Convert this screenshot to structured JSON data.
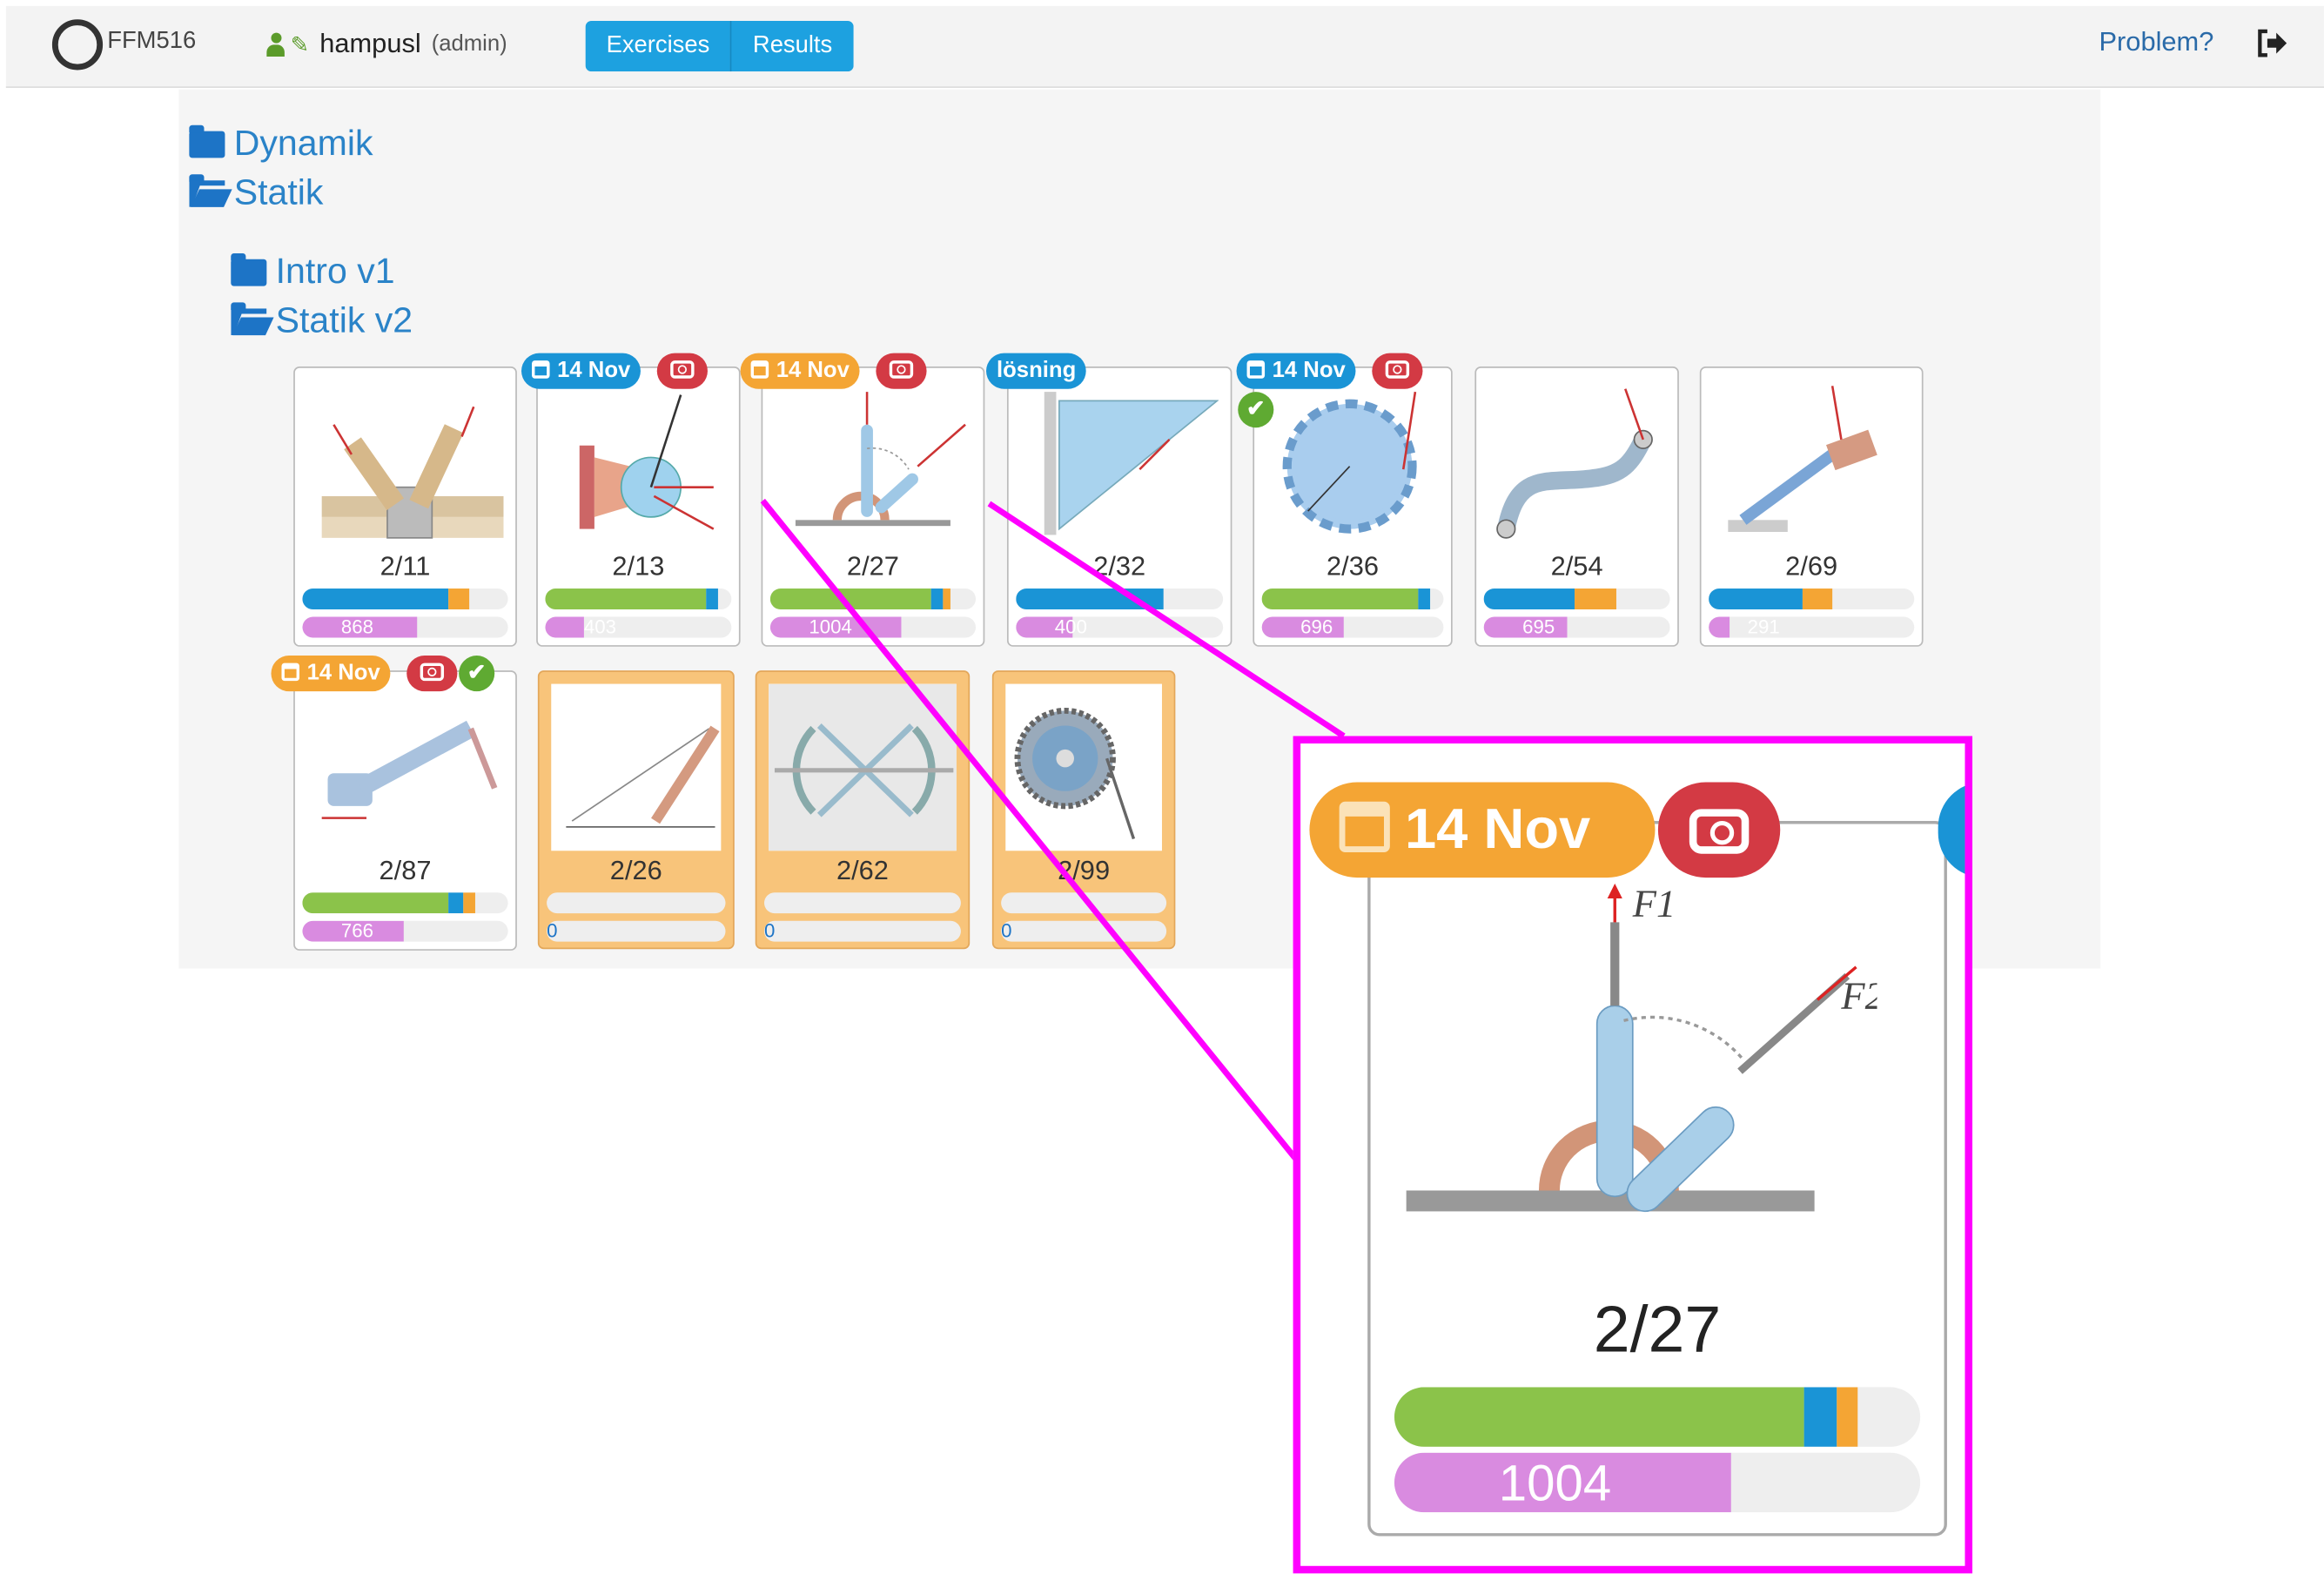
{
  "navbar": {
    "course": "FFM516",
    "user": "hampusl",
    "role": "(admin)",
    "nav_buttons": [
      "Exercises",
      "Results"
    ],
    "problem_link": "Problem?",
    "icons": [
      "logo-ring-icon",
      "user-icon",
      "pencil-icon",
      "logout-icon"
    ]
  },
  "folders": {
    "top": [
      {
        "label": "Dynamik",
        "state": "closed"
      },
      {
        "label": "Statik",
        "state": "open"
      }
    ],
    "sub": [
      {
        "label": "Intro v1",
        "state": "closed"
      },
      {
        "label": "Statik v2",
        "state": "open"
      }
    ]
  },
  "exercises": [
    {
      "label": "2/11",
      "badges": [],
      "progress": {
        "green": 0,
        "blue": 0.71,
        "orange": 0.1
      },
      "views": "868",
      "views_fraction": 0.56,
      "highlighted": false
    },
    {
      "label": "2/13",
      "badges": [
        {
          "type": "date",
          "text": "14 Nov",
          "color": "blue"
        },
        {
          "type": "camera",
          "color": "red"
        }
      ],
      "progress": {
        "green": 0.86,
        "blue": 0.07,
        "orange": 0
      },
      "views": "403",
      "views_fraction": 0.21,
      "highlighted": false
    },
    {
      "label": "2/27",
      "badges": [
        {
          "type": "date",
          "text": "14 Nov",
          "color": "orange"
        },
        {
          "type": "camera",
          "color": "red"
        }
      ],
      "progress": {
        "green": 0.78,
        "blue": 0.06,
        "orange": 0.04
      },
      "views": "1004",
      "views_fraction": 0.64,
      "highlighted": false
    },
    {
      "label": "2/32",
      "badges": [
        {
          "type": "text",
          "text": "lösning",
          "color": "blue"
        }
      ],
      "progress": {
        "green": 0,
        "blue": 0.71,
        "orange": 0
      },
      "views": "400",
      "views_fraction": 0.27,
      "highlighted": false
    },
    {
      "label": "2/36",
      "badges": [
        {
          "type": "date",
          "text": "14 Nov",
          "color": "blue"
        },
        {
          "type": "camera",
          "color": "red"
        },
        {
          "type": "check",
          "color": "green"
        }
      ],
      "progress": {
        "green": 0.86,
        "blue": 0.07,
        "orange": 0
      },
      "views": "696",
      "views_fraction": 0.45,
      "highlighted": false
    },
    {
      "label": "2/54",
      "badges": [],
      "progress": {
        "green": 0,
        "blue": 0.49,
        "orange": 0.22
      },
      "views": "695",
      "views_fraction": 0.45,
      "highlighted": false
    },
    {
      "label": "2/69",
      "badges": [],
      "progress": {
        "green": 0,
        "blue": 0.46,
        "orange": 0.14
      },
      "views": "291",
      "views_fraction": 0.1,
      "highlighted": false
    },
    {
      "label": "2/87",
      "badges": [
        {
          "type": "date",
          "text": "14 Nov",
          "color": "orange"
        },
        {
          "type": "camera",
          "color": "red"
        },
        {
          "type": "check",
          "color": "green"
        }
      ],
      "progress": {
        "green": 0.71,
        "blue": 0.07,
        "orange": 0.06
      },
      "views": "766",
      "views_fraction": 0.49,
      "highlighted": false
    },
    {
      "label": "2/26",
      "badges": [],
      "progress": {
        "green": 0,
        "blue": 0,
        "orange": 0
      },
      "views": "0",
      "views_fraction": 0,
      "highlighted": true
    },
    {
      "label": "2/62",
      "badges": [],
      "progress": {
        "green": 0,
        "blue": 0,
        "orange": 0
      },
      "views": "0",
      "views_fraction": 0,
      "highlighted": true
    },
    {
      "label": "2/99",
      "badges": [],
      "progress": {
        "green": 0,
        "blue": 0,
        "orange": 0
      },
      "views": "0",
      "views_fraction": 0,
      "highlighted": true
    }
  ],
  "zoom": {
    "badge_date": "14 Nov",
    "label": "2/27",
    "views": "1004",
    "progress": {
      "green": 0.78,
      "blue": 0.06,
      "orange": 0.04
    },
    "views_fraction": 0.64,
    "diagram_labels": [
      "F1",
      "F2"
    ]
  },
  "colors": {
    "accent_blue": "#1da1e0",
    "progress_green": "#8bc34a",
    "progress_blue": "#1a94d6",
    "progress_orange": "#f4a534",
    "views_pink": "#d98be0",
    "highlight_orange": "#f8c47a",
    "zoom_border": "#ff00ff"
  }
}
